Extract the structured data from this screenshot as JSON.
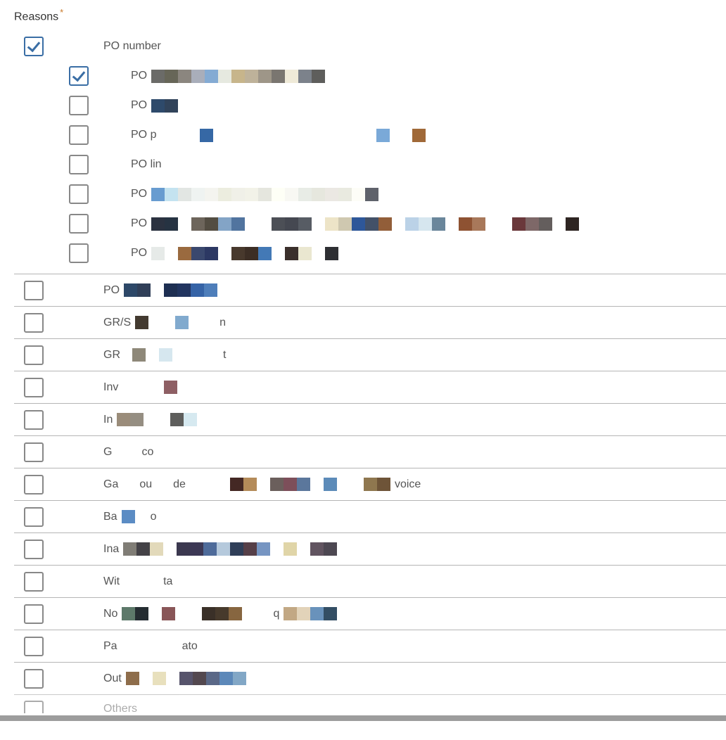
{
  "section_label": "Reasons",
  "required_mark": "*",
  "top_group": {
    "checked": true,
    "label": "PO number",
    "sub_items": [
      {
        "checked": true,
        "prefix": "PO"
      },
      {
        "checked": false,
        "prefix": "PO"
      },
      {
        "checked": false,
        "prefix": "PO p"
      },
      {
        "checked": false,
        "prefix": "PO lin"
      },
      {
        "checked": false,
        "prefix": "PO"
      },
      {
        "checked": false,
        "prefix": "PO"
      },
      {
        "checked": false,
        "prefix": "PO"
      }
    ]
  },
  "main_items": [
    {
      "prefix": "PO"
    },
    {
      "prefix": "GR/S",
      "suffix": "n"
    },
    {
      "prefix": "GR",
      "suffix": "t"
    },
    {
      "prefix": "Inv"
    },
    {
      "prefix": "In"
    },
    {
      "prefix": "G",
      "suffix": "co"
    },
    {
      "prefix": "Ga",
      "mid": "ou",
      "mid2": "de",
      "suffix": "voice"
    },
    {
      "prefix": "Ba",
      "suffix": "o"
    },
    {
      "prefix": "Ina"
    },
    {
      "prefix": "Wit",
      "mid": "ta"
    },
    {
      "prefix": "No",
      "suffix": "q"
    },
    {
      "prefix": "Pa",
      "suffix": "ato"
    },
    {
      "prefix": "Out"
    }
  ],
  "others_label": "Others"
}
